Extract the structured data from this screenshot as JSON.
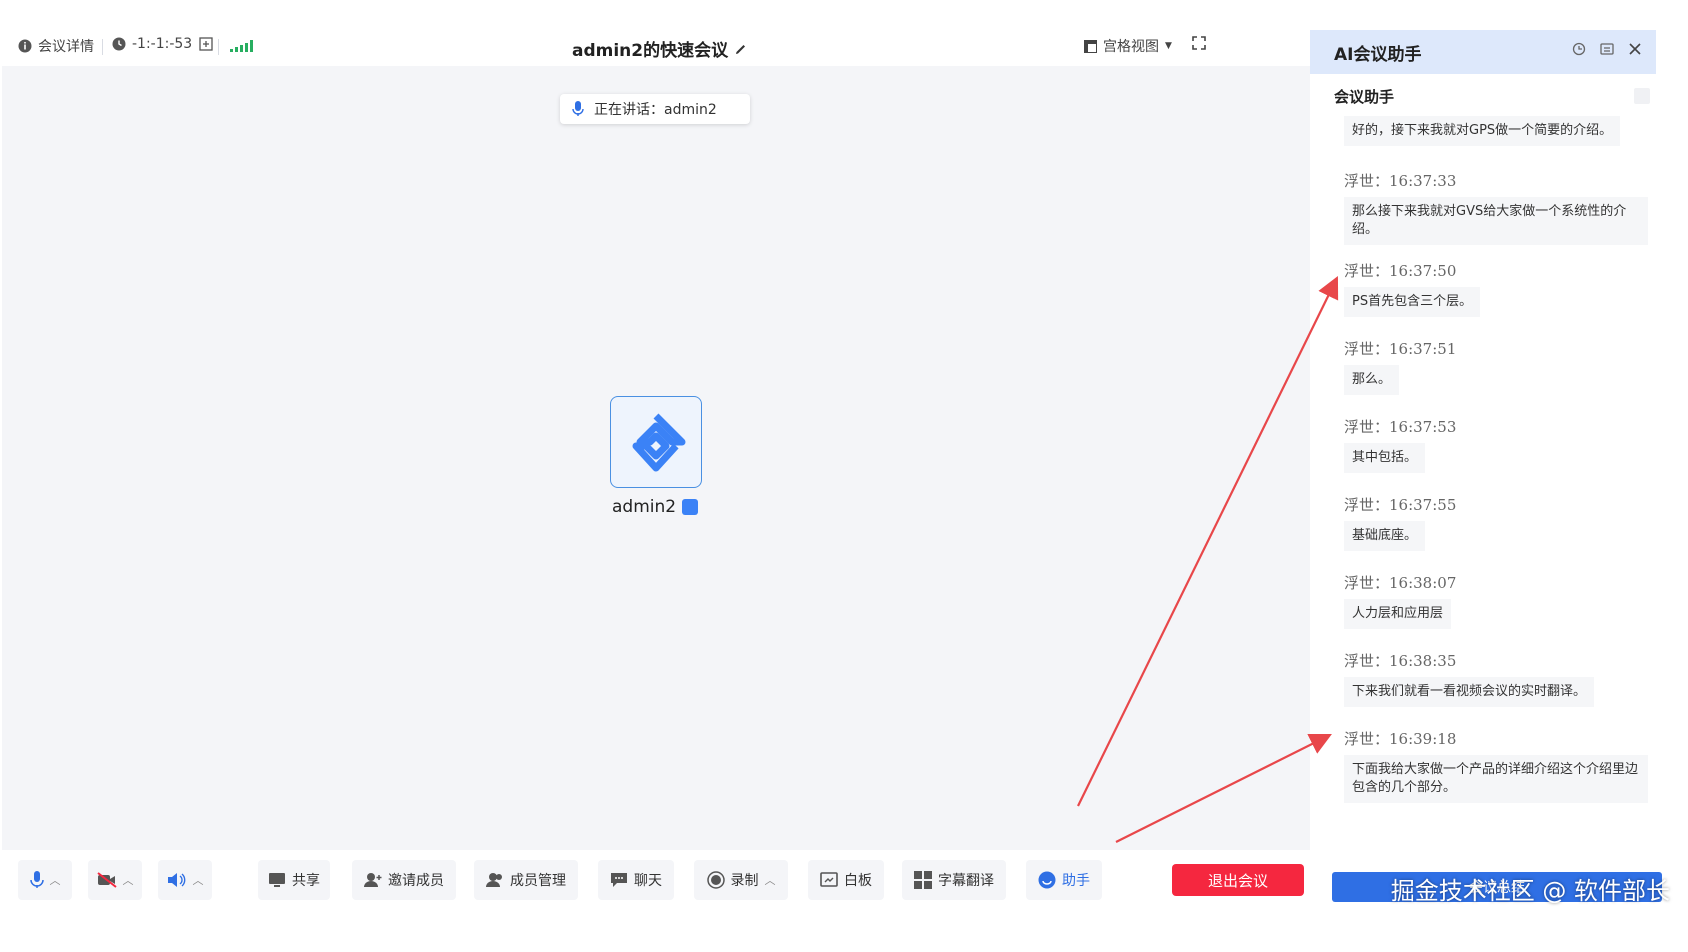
{
  "topbar": {
    "meeting_details": "会议详情",
    "timer": "-1:-1:-53",
    "title": "admin2的快速会议",
    "view_mode": "宫格视图"
  },
  "stage": {
    "speaking_label": "正在讲话：admin2",
    "participant_name": "admin2"
  },
  "toolbar": {
    "share": "共享",
    "invite": "邀请成员",
    "members": "成员管理",
    "chat": "聊天",
    "record": "录制",
    "whiteboard": "白板",
    "subtitle": "字幕翻译",
    "assistant": "助手",
    "exit": "退出会议"
  },
  "panel": {
    "title": "AI会议助手",
    "subtitle": "会议助手",
    "summary_button": "会议总结",
    "messages": [
      {
        "meta": "",
        "text": "好的，接下来我就对GPS做一个简要的介绍。"
      },
      {
        "meta": "浮世：16:37:33",
        "text": "那么接下来我就对GVS给大家做一个系统性的介绍。"
      },
      {
        "meta": "浮世：16:37:50",
        "text": "PS首先包含三个层。"
      },
      {
        "meta": "浮世：16:37:51",
        "text": "那么。"
      },
      {
        "meta": "浮世：16:37:53",
        "text": "其中包括。"
      },
      {
        "meta": "浮世：16:37:55",
        "text": "基础底座。"
      },
      {
        "meta": "浮世：16:38:07",
        "text": "人力层和应用层"
      },
      {
        "meta": "浮世：16:38:35",
        "text": "下来我们就看一看视频会议的实时翻译。"
      },
      {
        "meta": "浮世：16:39:18",
        "text": "下面我给大家做一个产品的详细介绍这个介绍里边包含的几个部分。"
      }
    ]
  },
  "watermark": "掘金技术社区 @ 软件部长",
  "colors": {
    "accent": "#2f6fe4",
    "exit": "#f5273f",
    "panel_header": "#dde8fb",
    "arrow": "#e8474a"
  }
}
